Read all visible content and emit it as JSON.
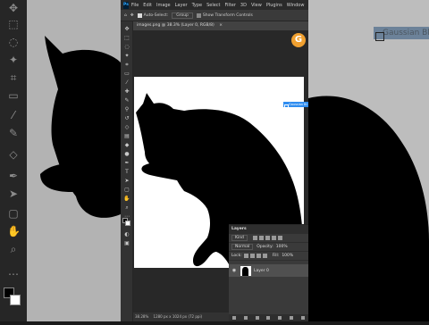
{
  "menubar": {
    "logo": "Ps",
    "items": [
      "File",
      "Edit",
      "Image",
      "Layer",
      "Type",
      "Select",
      "Filter",
      "3D",
      "View",
      "Plugins",
      "Window",
      "He"
    ]
  },
  "options": {
    "auto_select_label": "Auto-Select:",
    "auto_select_value": "Group",
    "show_transform_label": "Show Transform Controls"
  },
  "document": {
    "tab_title": "images.png @ 38.3% (Layer 0, RGB/8)",
    "close": "×"
  },
  "badge": {
    "letter": "G",
    "color": "#f0a030"
  },
  "overlay_label": "Gaussian Bl",
  "status": {
    "zoom": "38.28%",
    "doc_size": "1280 px x 1024 px (72 ppi)"
  },
  "layers_panel": {
    "title": "Layers",
    "filter": "Kind",
    "blend_mode": "Normal",
    "opacity_label": "Opacity:",
    "opacity_value": "100%",
    "lock_label": "Lock:",
    "fill_label": "Fill:",
    "fill_value": "100%",
    "layers": [
      {
        "name": "Layer 0",
        "visible": true
      }
    ]
  },
  "icons": [
    "move-icon",
    "marquee-icon",
    "lasso-icon",
    "quick-select-icon",
    "crop-icon",
    "frame-icon",
    "eyedropper-icon",
    "healing-icon",
    "brush-icon",
    "stamp-icon",
    "history-brush-icon",
    "eraser-icon",
    "gradient-icon",
    "blur-icon",
    "dodge-icon",
    "pen-icon",
    "type-icon",
    "path-select-icon",
    "shape-icon",
    "hand-icon",
    "zoom-icon"
  ]
}
